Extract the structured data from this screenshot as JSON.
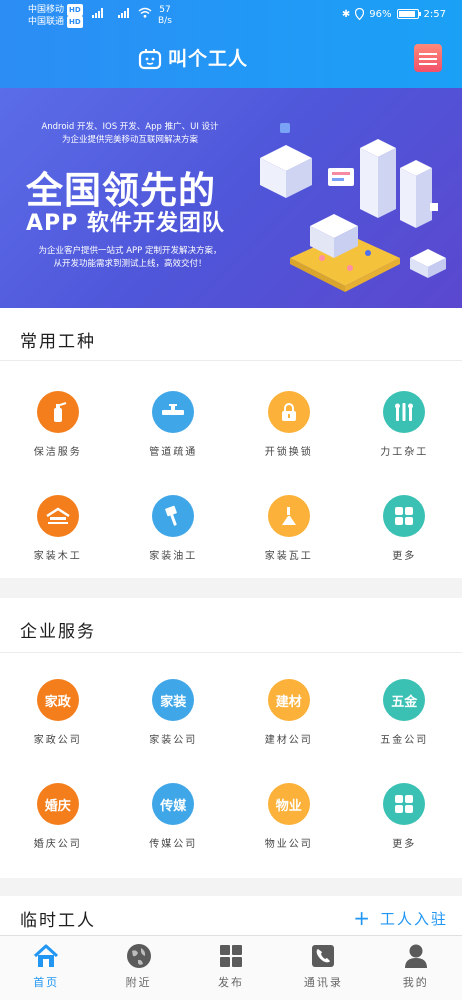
{
  "status_bar": {
    "carrier1": "中国移动",
    "carrier2": "中国联通",
    "hd": "HD",
    "net": "4G",
    "speed_value": "57",
    "speed_unit": "B/s",
    "battery": "96%",
    "time": "2:57"
  },
  "header": {
    "brand": "叫个工人"
  },
  "banner": {
    "line1": "Android 开发、IOS 开发、App 推广、UI 设计",
    "line2": "为企业提供完美移动互联网解决方案",
    "title": "全国领先的",
    "subtitle": "APP 软件开发团队",
    "desc1": "为企业客户提供一站式 APP 定制开发解决方案，",
    "desc2": "从开发功能需求到测试上线，高效交付！"
  },
  "common": {
    "title": "常用工种",
    "items": [
      {
        "label": "保洁服务",
        "color": "#f47e1c",
        "icon": "fire-extinguisher-icon"
      },
      {
        "label": "管道疏通",
        "color": "#3fa6e8",
        "icon": "pipe-icon"
      },
      {
        "label": "开锁换锁",
        "color": "#fbb13a",
        "icon": "lock-icon"
      },
      {
        "label": "力工杂工",
        "color": "#3ac1b4",
        "icon": "tools-icon"
      },
      {
        "label": "家装木工",
        "color": "#f47e1c",
        "icon": "roof-icon"
      },
      {
        "label": "家装油工",
        "color": "#3fa6e8",
        "icon": "paint-brush-icon"
      },
      {
        "label": "家装瓦工",
        "color": "#fbb13a",
        "icon": "trowel-icon"
      },
      {
        "label": "更多",
        "color": "#3ac1b4",
        "icon": "grid-icon"
      }
    ]
  },
  "enterprise": {
    "title": "企业服务",
    "items": [
      {
        "label": "家政公司",
        "badge": "家政",
        "color": "#f47e1c"
      },
      {
        "label": "家装公司",
        "badge": "家装",
        "color": "#3fa6e8"
      },
      {
        "label": "建材公司",
        "badge": "建材",
        "color": "#fbb13a"
      },
      {
        "label": "五金公司",
        "badge": "五金",
        "color": "#3ac1b4"
      },
      {
        "label": "婚庆公司",
        "badge": "婚庆",
        "color": "#f47e1c"
      },
      {
        "label": "传媒公司",
        "badge": "传媒",
        "color": "#3fa6e8"
      },
      {
        "label": "物业公司",
        "badge": "物业",
        "color": "#fbb13a"
      },
      {
        "label": "更多",
        "badge": "",
        "color": "#3ac1b4"
      }
    ]
  },
  "temp": {
    "title": "临时工人",
    "add_label": "工人入驻"
  },
  "nav": {
    "items": [
      {
        "label": "首页",
        "icon": "home-icon"
      },
      {
        "label": "附近",
        "icon": "globe-icon"
      },
      {
        "label": "发布",
        "icon": "apps-icon"
      },
      {
        "label": "通讯录",
        "icon": "phone-icon"
      },
      {
        "label": "我的",
        "icon": "user-icon"
      }
    ],
    "active_color": "#2196f3"
  }
}
